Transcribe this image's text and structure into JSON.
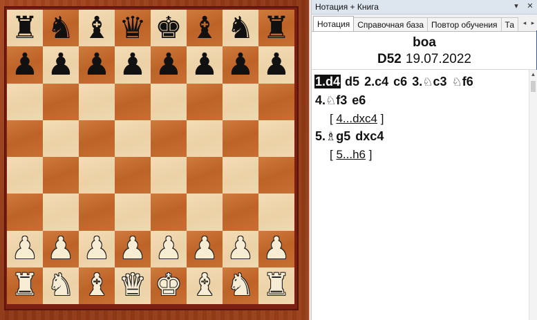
{
  "panel": {
    "title": "Нотация + Книга",
    "pin_icon": "▾",
    "close_icon": "✕",
    "tabs": [
      {
        "label": "Нотация"
      },
      {
        "label": "Справочная база"
      },
      {
        "label": "Повтор обучения"
      },
      {
        "label": "Та"
      }
    ],
    "tab_left": "◂",
    "tab_right": "▸"
  },
  "game": {
    "players": "boa",
    "eco": "D52",
    "date": "19.07.2022"
  },
  "notation": {
    "line1": [
      {
        "text": "1.d4",
        "selected": true
      },
      {
        "text": "d5"
      },
      {
        "text": "2.c4"
      },
      {
        "text": "c6"
      },
      {
        "num": "3.",
        "fig": "♘",
        "rest": "c3"
      },
      {
        "fig": "♘",
        "rest": "f6"
      }
    ],
    "line2": [
      {
        "num": "4.",
        "fig": "♘",
        "rest": "f3"
      },
      {
        "text": "e6"
      }
    ],
    "var1": {
      "open": "[",
      "move": "4...dxc4",
      "close": "]"
    },
    "line3": [
      {
        "num": "5.",
        "fig": "♗",
        "rest": "g5"
      },
      {
        "text": "dxc4"
      }
    ],
    "var2": {
      "open": "[",
      "move": "5...h6",
      "close": "]"
    }
  },
  "board": {
    "rows": [
      [
        "r",
        "n",
        "b",
        "q",
        "k",
        "b",
        "n",
        "r"
      ],
      [
        "p",
        "p",
        "p",
        "p",
        "p",
        "p",
        "p",
        "p"
      ],
      [
        "",
        "",
        "",
        "",
        "",
        "",
        "",
        ""
      ],
      [
        "",
        "",
        "",
        "",
        "",
        "",
        "",
        ""
      ],
      [
        "",
        "",
        "",
        "",
        "",
        "",
        "",
        ""
      ],
      [
        "",
        "",
        "",
        "",
        "",
        "",
        "",
        ""
      ],
      [
        "P",
        "P",
        "P",
        "P",
        "P",
        "P",
        "P",
        "P"
      ],
      [
        "R",
        "N",
        "B",
        "Q",
        "K",
        "B",
        "N",
        "R"
      ]
    ],
    "colors": {
      "light": "#f0d8b0",
      "dark": "#c46a30",
      "frame": "#7a1f12"
    }
  },
  "scroll": {
    "up_icon": "▲"
  }
}
